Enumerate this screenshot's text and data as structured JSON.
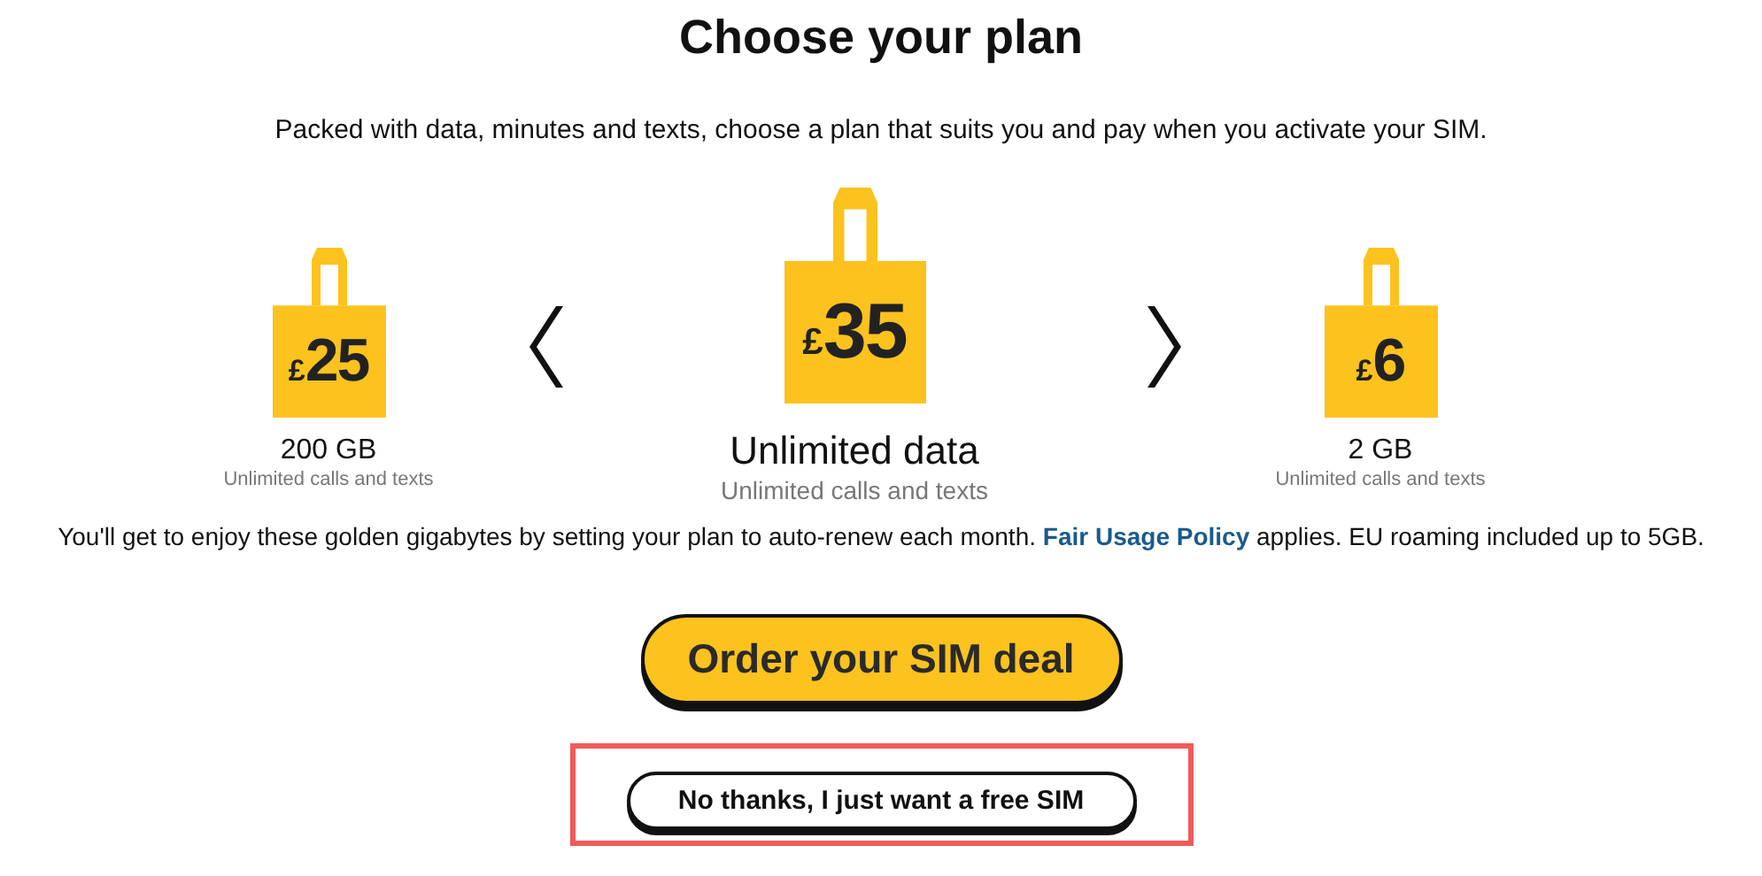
{
  "title": "Choose your plan",
  "intro": "Packed with data, minutes and texts, choose a plan that suits you and pay when you activate your SIM.",
  "plans": [
    {
      "currency": "£",
      "price": "25",
      "data": "200 GB",
      "extras": "Unlimited calls and texts",
      "selected": false
    },
    {
      "currency": "£",
      "price": "35",
      "data": "Unlimited data",
      "extras": "Unlimited calls and texts",
      "selected": true
    },
    {
      "currency": "£",
      "price": "6",
      "data": "2 GB",
      "extras": "Unlimited calls and texts",
      "selected": false
    }
  ],
  "note": {
    "before": "You'll get to enjoy these golden gigabytes by setting your plan to auto-renew each month.",
    "link": "Fair Usage Policy",
    "after": "applies. EU roaming included up to 5GB."
  },
  "primary_button": "Order your SIM deal",
  "secondary_button": {
    "label": "No thanks, I just want a free SIM",
    "highlighted": true
  }
}
